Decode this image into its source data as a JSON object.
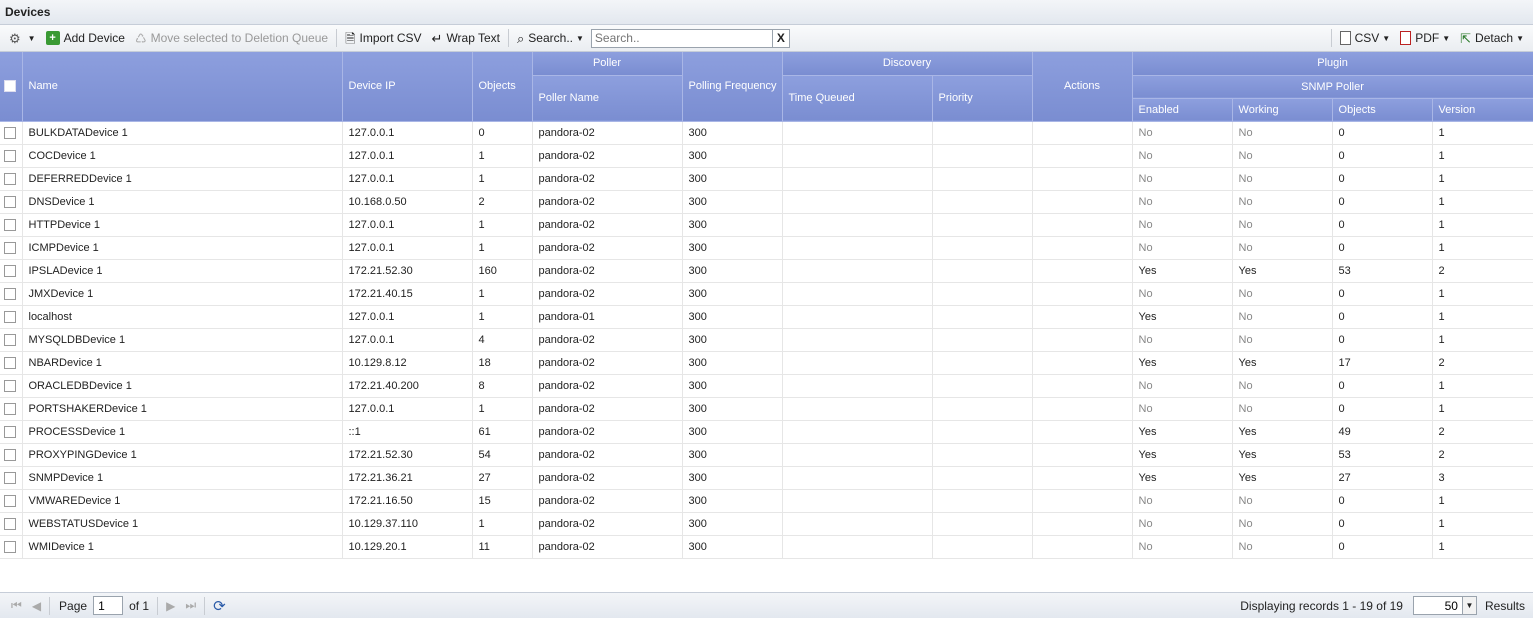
{
  "window": {
    "title": "Devices"
  },
  "toolbar": {
    "add_device": "Add Device",
    "move_to_deletion": "Move selected to Deletion Queue",
    "import_csv": "Import CSV",
    "wrap_text": "Wrap Text",
    "search_menu": "Search..",
    "search_placeholder": "Search..",
    "clear": "X",
    "csv": "CSV",
    "pdf": "PDF",
    "detach": "Detach"
  },
  "headers": {
    "name": "Name",
    "device_ip": "Device IP",
    "objects": "Objects",
    "poller": "Poller",
    "poller_name": "Poller Name",
    "polling_frequency": "Polling Frequency",
    "discovery": "Discovery",
    "time_queued": "Time Queued",
    "priority": "Priority",
    "actions": "Actions",
    "plugin": "Plugin",
    "snmp_poller": "SNMP Poller",
    "enabled": "Enabled",
    "working": "Working",
    "plugin_objects": "Objects",
    "version": "Version"
  },
  "rows": [
    {
      "name": "BULKDATADevice 1",
      "ip": "127.0.0.1",
      "objects": "0",
      "poller": "pandora-02",
      "freq": "300",
      "enabled": "No",
      "working": "No",
      "pobjects": "0",
      "version": "1"
    },
    {
      "name": "COCDevice 1",
      "ip": "127.0.0.1",
      "objects": "1",
      "poller": "pandora-02",
      "freq": "300",
      "enabled": "No",
      "working": "No",
      "pobjects": "0",
      "version": "1"
    },
    {
      "name": "DEFERREDDevice 1",
      "ip": "127.0.0.1",
      "objects": "1",
      "poller": "pandora-02",
      "freq": "300",
      "enabled": "No",
      "working": "No",
      "pobjects": "0",
      "version": "1"
    },
    {
      "name": "DNSDevice 1",
      "ip": "10.168.0.50",
      "objects": "2",
      "poller": "pandora-02",
      "freq": "300",
      "enabled": "No",
      "working": "No",
      "pobjects": "0",
      "version": "1"
    },
    {
      "name": "HTTPDevice 1",
      "ip": "127.0.0.1",
      "objects": "1",
      "poller": "pandora-02",
      "freq": "300",
      "enabled": "No",
      "working": "No",
      "pobjects": "0",
      "version": "1"
    },
    {
      "name": "ICMPDevice 1",
      "ip": "127.0.0.1",
      "objects": "1",
      "poller": "pandora-02",
      "freq": "300",
      "enabled": "No",
      "working": "No",
      "pobjects": "0",
      "version": "1"
    },
    {
      "name": "IPSLADevice 1",
      "ip": "172.21.52.30",
      "objects": "160",
      "poller": "pandora-02",
      "freq": "300",
      "enabled": "Yes",
      "working": "Yes",
      "pobjects": "53",
      "version": "2"
    },
    {
      "name": "JMXDevice 1",
      "ip": "172.21.40.15",
      "objects": "1",
      "poller": "pandora-02",
      "freq": "300",
      "enabled": "No",
      "working": "No",
      "pobjects": "0",
      "version": "1"
    },
    {
      "name": "localhost",
      "ip": "127.0.0.1",
      "objects": "1",
      "poller": "pandora-01",
      "freq": "300",
      "enabled": "Yes",
      "working": "No",
      "pobjects": "0",
      "version": "1"
    },
    {
      "name": "MYSQLDBDevice 1",
      "ip": "127.0.0.1",
      "objects": "4",
      "poller": "pandora-02",
      "freq": "300",
      "enabled": "No",
      "working": "No",
      "pobjects": "0",
      "version": "1"
    },
    {
      "name": "NBARDevice 1",
      "ip": "10.129.8.12",
      "objects": "18",
      "poller": "pandora-02",
      "freq": "300",
      "enabled": "Yes",
      "working": "Yes",
      "pobjects": "17",
      "version": "2"
    },
    {
      "name": "ORACLEDBDevice 1",
      "ip": "172.21.40.200",
      "objects": "8",
      "poller": "pandora-02",
      "freq": "300",
      "enabled": "No",
      "working": "No",
      "pobjects": "0",
      "version": "1"
    },
    {
      "name": "PORTSHAKERDevice 1",
      "ip": "127.0.0.1",
      "objects": "1",
      "poller": "pandora-02",
      "freq": "300",
      "enabled": "No",
      "working": "No",
      "pobjects": "0",
      "version": "1"
    },
    {
      "name": "PROCESSDevice 1",
      "ip": "::1",
      "objects": "61",
      "poller": "pandora-02",
      "freq": "300",
      "enabled": "Yes",
      "working": "Yes",
      "pobjects": "49",
      "version": "2"
    },
    {
      "name": "PROXYPINGDevice 1",
      "ip": "172.21.52.30",
      "objects": "54",
      "poller": "pandora-02",
      "freq": "300",
      "enabled": "Yes",
      "working": "Yes",
      "pobjects": "53",
      "version": "2"
    },
    {
      "name": "SNMPDevice 1",
      "ip": "172.21.36.21",
      "objects": "27",
      "poller": "pandora-02",
      "freq": "300",
      "enabled": "Yes",
      "working": "Yes",
      "pobjects": "27",
      "version": "3"
    },
    {
      "name": "VMWAREDevice 1",
      "ip": "172.21.16.50",
      "objects": "15",
      "poller": "pandora-02",
      "freq": "300",
      "enabled": "No",
      "working": "No",
      "pobjects": "0",
      "version": "1"
    },
    {
      "name": "WEBSTATUSDevice 1",
      "ip": "10.129.37.110",
      "objects": "1",
      "poller": "pandora-02",
      "freq": "300",
      "enabled": "No",
      "working": "No",
      "pobjects": "0",
      "version": "1"
    },
    {
      "name": "WMIDevice 1",
      "ip": "10.129.20.1",
      "objects": "11",
      "poller": "pandora-02",
      "freq": "300",
      "enabled": "No",
      "working": "No",
      "pobjects": "0",
      "version": "1"
    }
  ],
  "footer": {
    "page_label": "Page",
    "page_value": "1",
    "of_label": "of 1",
    "displaying": "Displaying records 1 - 19 of 19",
    "page_size": "50",
    "results_label": "Results"
  },
  "icons": {
    "gear": "gear-icon",
    "add": "add-device-icon",
    "delete": "deletion-queue-icon",
    "import": "import-csv-icon",
    "wrap": "wrap-text-icon",
    "search": "search-icon",
    "csv": "csv-icon",
    "pdf": "pdf-icon",
    "detach": "detach-icon",
    "refresh": "refresh-icon"
  },
  "colors": {
    "header": "#8597da",
    "toolbar": "#eef1f5"
  }
}
